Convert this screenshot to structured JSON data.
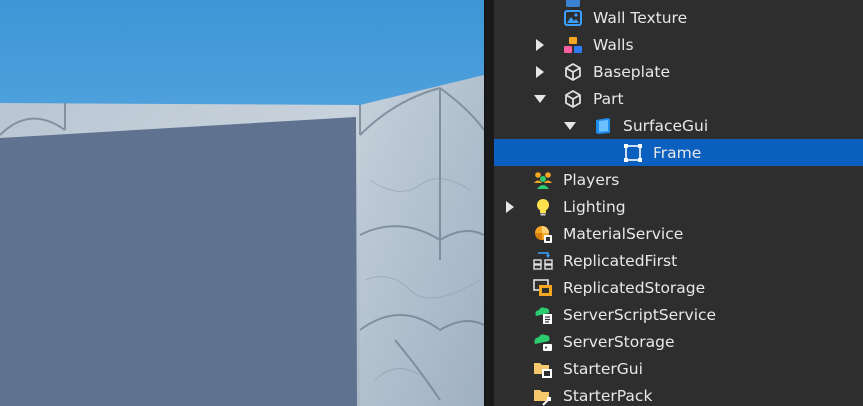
{
  "explorer": {
    "items": [
      {
        "label": "Wall Texture",
        "icon": "image-icon",
        "expand": "none",
        "indent": 2,
        "selected": false
      },
      {
        "label": "Walls",
        "icon": "model-icon",
        "expand": "collapsed",
        "indent": 2,
        "selected": false
      },
      {
        "label": "Baseplate",
        "icon": "part-icon",
        "expand": "collapsed",
        "indent": 2,
        "selected": false
      },
      {
        "label": "Part",
        "icon": "part-icon",
        "expand": "expanded",
        "indent": 2,
        "selected": false
      },
      {
        "label": "SurfaceGui",
        "icon": "surfacegui-icon",
        "expand": "expanded",
        "indent": 3,
        "selected": false
      },
      {
        "label": "Frame",
        "icon": "frame-icon",
        "expand": "none",
        "indent": 4,
        "selected": true
      },
      {
        "label": "Players",
        "icon": "players-icon",
        "expand": "none",
        "indent": 1,
        "selected": false
      },
      {
        "label": "Lighting",
        "icon": "lightbulb-icon",
        "expand": "collapsed",
        "indent": 1,
        "selected": false
      },
      {
        "label": "MaterialService",
        "icon": "material-service-icon",
        "expand": "none",
        "indent": 1,
        "selected": false
      },
      {
        "label": "ReplicatedFirst",
        "icon": "replicated-first-icon",
        "expand": "none",
        "indent": 1,
        "selected": false
      },
      {
        "label": "ReplicatedStorage",
        "icon": "replicated-storage-icon",
        "expand": "none",
        "indent": 1,
        "selected": false
      },
      {
        "label": "ServerScriptService",
        "icon": "server-script-service-icon",
        "expand": "none",
        "indent": 1,
        "selected": false
      },
      {
        "label": "ServerStorage",
        "icon": "server-storage-icon",
        "expand": "none",
        "indent": 1,
        "selected": false
      },
      {
        "label": "StarterGui",
        "icon": "starter-gui-icon",
        "expand": "none",
        "indent": 1,
        "selected": false
      },
      {
        "label": "StarterPack",
        "icon": "starter-pack-icon",
        "expand": "none",
        "indent": 1,
        "selected": false
      }
    ]
  },
  "colors": {
    "selection": "#0b5fbf",
    "panel_bg": "#2e2e2e",
    "sky": "#4fa3de",
    "frame_fill": "#5f7391"
  }
}
